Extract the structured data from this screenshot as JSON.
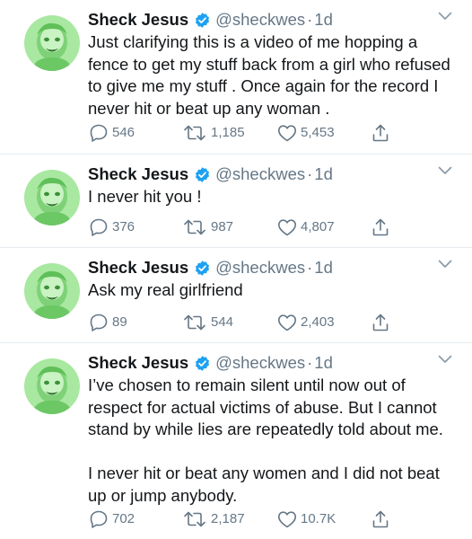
{
  "colors": {
    "text": "#14171a",
    "secondary": "#657786",
    "verified": "#1da1f2",
    "divider": "#e6ecf0",
    "avatar": "#a8e8a0"
  },
  "icons": [
    "verified-badge-icon",
    "chevron-down-icon",
    "reply-icon",
    "retweet-icon",
    "like-icon",
    "share-icon"
  ],
  "tweets": [
    {
      "name": "Sheck Jesus",
      "handle": "@sheckwes",
      "sep": "·",
      "time": "1d",
      "text": "Just clarifying this is a video of me hopping a fence to get my stuff back from a girl who refused to give me my stuff . Once again for the record I never hit or beat up any woman .",
      "replies": "546",
      "retweets": "1,185",
      "likes": "5,453"
    },
    {
      "name": "Sheck Jesus",
      "handle": "@sheckwes",
      "sep": "·",
      "time": "1d",
      "text": "I never hit you !",
      "replies": "376",
      "retweets": "987",
      "likes": "4,807"
    },
    {
      "name": "Sheck Jesus",
      "handle": "@sheckwes",
      "sep": "·",
      "time": "1d",
      "text": "Ask my real girlfriend",
      "replies": "89",
      "retweets": "544",
      "likes": "2,403"
    },
    {
      "name": "Sheck Jesus",
      "handle": "@sheckwes",
      "sep": "·",
      "time": "1d",
      "text": "I’ve chosen to remain silent until now out of respect for actual victims of abuse.  But I cannot stand by while lies are repeatedly told about me.\n\nI never hit or beat any women and I did not beat up or jump anybody.",
      "replies": "702",
      "retweets": "2,187",
      "likes": "10.7K"
    }
  ]
}
